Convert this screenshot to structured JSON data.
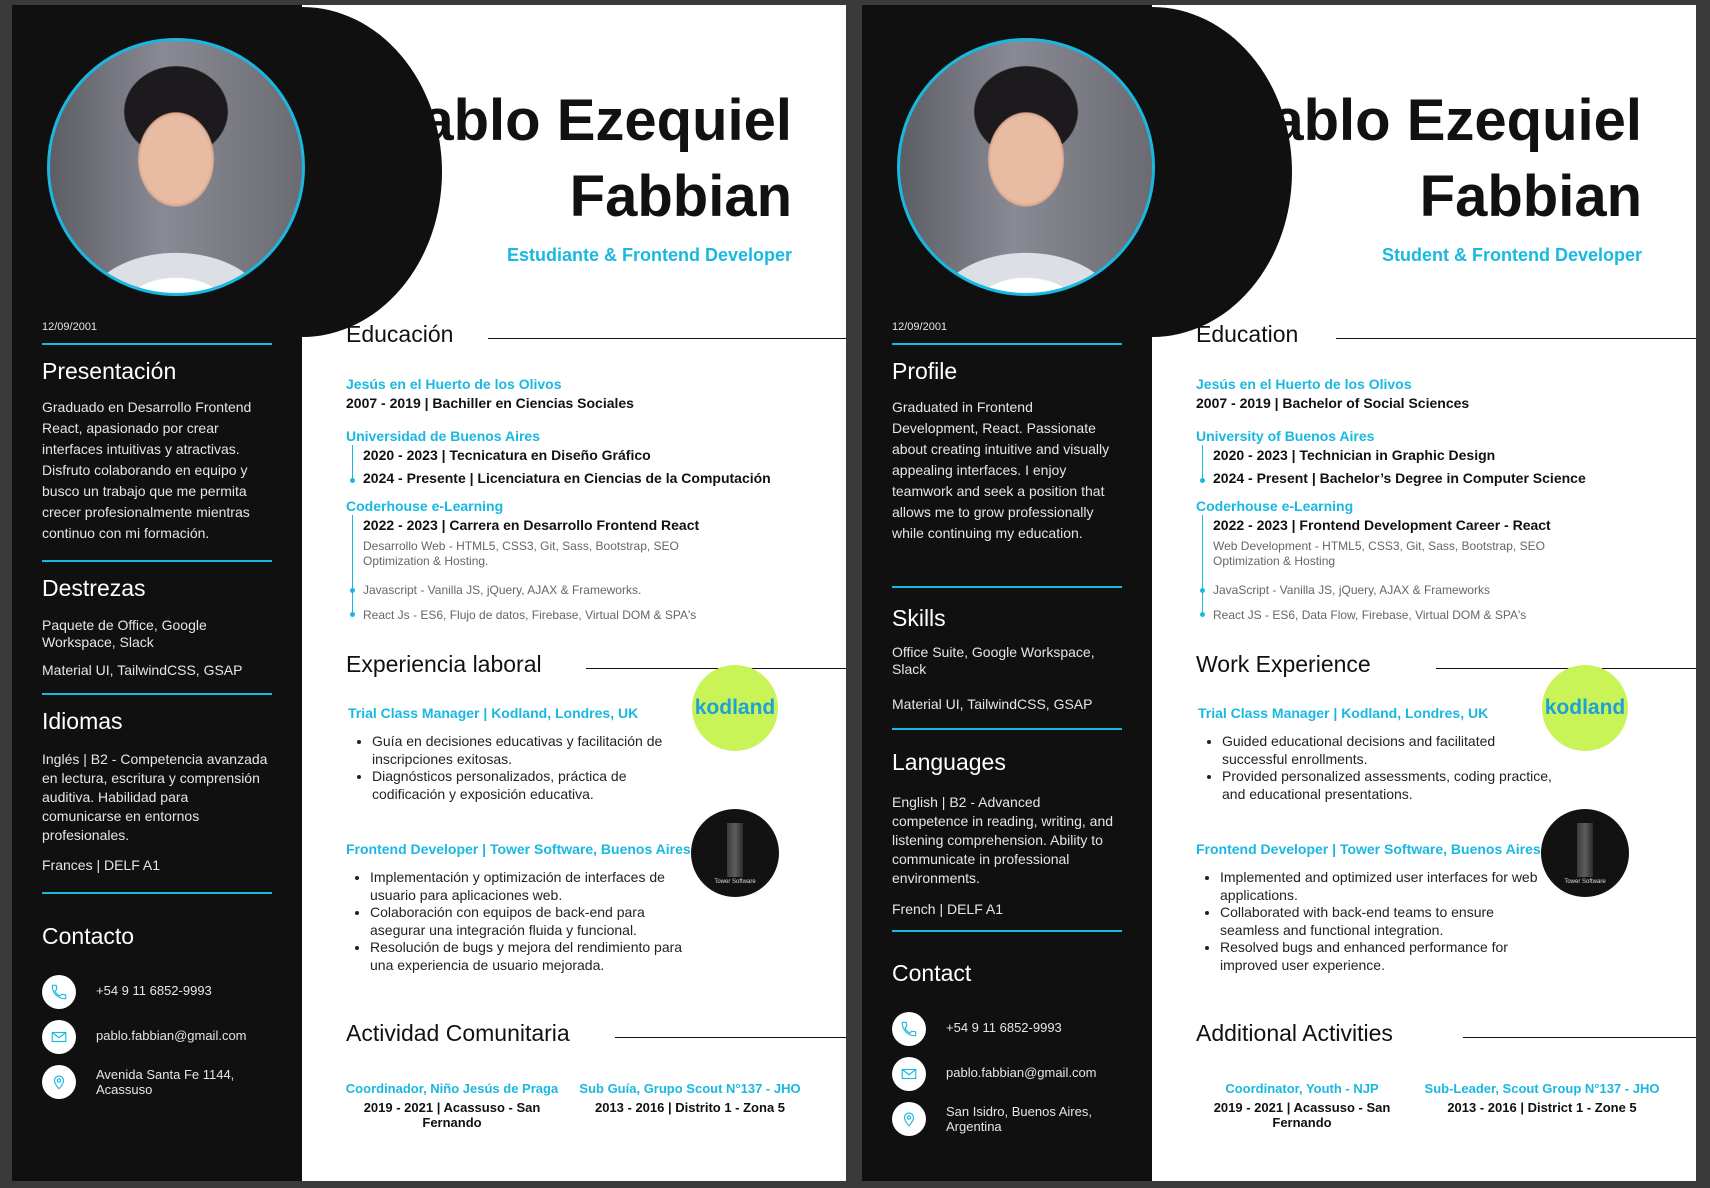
{
  "accent_color": "#19b8e0",
  "sidebar_color": "#101010",
  "es": {
    "name_line1": "Pablo Ezequiel",
    "name_line2": "Fabbian",
    "role": "Estudiante & Frontend Developer",
    "dob": "12/09/2001",
    "profile_title": "Presentación",
    "profile_text": "Graduado en Desarrollo Frontend React, apasionado por crear interfaces intuitivas y atractivas. Disfruto colaborando en equipo y busco un trabajo que me permita crecer profesionalmente mientras continuo con mi formación.",
    "skills_title": "Destrezas",
    "skills": [
      "Paquete de Office, Google Workspace, Slack",
      "Material UI, TailwindCSS, GSAP"
    ],
    "languages_title": "Idiomas",
    "languages": [
      "Inglés | B2 - Competencia avanzada en lectura, escritura y comprensión auditiva. Habilidad para comunicarse en entornos profesionales.",
      "Frances | DELF A1"
    ],
    "contact_title": "Contacto",
    "phone": "+54 9 11 6852-9993",
    "email": "pablo.fabbian@gmail.com",
    "address": "Avenida Santa Fe 1144, Acassuso",
    "education_title": "Educación",
    "edu": [
      {
        "inst": "Jesús en el Huerto de los Olivos",
        "degrees": [
          "2007 - 2019 | Bachiller en Ciencias Sociales"
        ]
      },
      {
        "inst": "Universidad de Buenos Aires",
        "degrees": [
          "2020 - 2023 | Tecnicatura en Diseño Gráfico",
          "2024 - Presente | Licenciatura en Ciencias de la Computación"
        ]
      },
      {
        "inst": "Coderhouse  e-Learning",
        "degrees": [
          "2022 - 2023 | Carrera en Desarrollo Frontend React"
        ],
        "details": [
          "Desarrollo Web - HTML5, CSS3, Git, Sass, Bootstrap, SEO Optimization & Hosting.",
          "Javascript - Vanilla JS, jQuery, AJAX & Frameworks.",
          "React Js - ES6, Flujo de datos, Firebase, Virtual DOM & SPA's"
        ]
      }
    ],
    "work_title": "Experiencia laboral",
    "jobs": [
      {
        "title": "Trial Class Manager | Kodland, Londres, UK",
        "bullets": [
          "Guía en decisiones educativas y facilitación de inscripciones exitosas.",
          "Diagnósticos personalizados, práctica de codificación y exposición educativa."
        ]
      },
      {
        "title": "Frontend Developer | Tower Software, Buenos Aires",
        "bullets": [
          "Implementación y optimización de interfaces de usuario para aplicaciones web.",
          "Colaboración con equipos de back-end para asegurar una integración fluida y funcional.",
          "Resolución de bugs y mejora del rendimiento para una experiencia de usuario mejorada."
        ]
      }
    ],
    "activities_title": "Actividad Comunitaria",
    "activities": [
      {
        "title": "Coordinador, Niño Jesús de Praga",
        "sub": "2019 - 2021 | Acassuso - San Fernando"
      },
      {
        "title": "Sub Guía, Grupo Scout N°137 - JHO",
        "sub": "2013 - 2016 | Distrito 1 - Zona 5"
      }
    ]
  },
  "en": {
    "name_line1": "Pablo Ezequiel",
    "name_line2": "Fabbian",
    "role": "Student & Frontend Developer",
    "dob": "12/09/2001",
    "profile_title": "Profile",
    "profile_text": "Graduated in Frontend Development, React. Passionate about creating intuitive and visually appealing interfaces. I enjoy teamwork and seek a position that allows me to grow professionally while continuing my education.",
    "skills_title": "Skills",
    "skills": [
      "Office Suite, Google Workspace, Slack",
      "Material UI, TailwindCSS, GSAP"
    ],
    "languages_title": "Languages",
    "languages": [
      "English | B2 - Advanced competence in reading, writing, and listening comprehension. Ability to communicate in professional environments.",
      "French | DELF A1"
    ],
    "contact_title": "Contact",
    "phone": "+54 9 11 6852-9993",
    "email": "pablo.fabbian@gmail.com",
    "address": "San Isidro, Buenos Aires, Argentina",
    "education_title": "Education",
    "edu": [
      {
        "inst": "Jesús en el Huerto de los Olivos",
        "degrees": [
          "2007 - 2019 | Bachelor of Social Sciences"
        ]
      },
      {
        "inst": "University of Buenos Aires",
        "degrees": [
          "2020 - 2023 | Technician in Graphic Design",
          "2024 - Present | Bachelor’s Degree in Computer Science"
        ]
      },
      {
        "inst": "Coderhouse  e-Learning",
        "degrees": [
          "2022 - 2023 | Frontend Development Career - React"
        ],
        "details": [
          "Web Development - HTML5, CSS3, Git, Sass, Bootstrap, SEO Optimization & Hosting",
          "JavaScript - Vanilla JS, jQuery, AJAX & Frameworks",
          "React JS - ES6, Data Flow, Firebase, Virtual DOM & SPA's"
        ]
      }
    ],
    "work_title": "Work Experience",
    "jobs": [
      {
        "title": "Trial Class Manager | Kodland, Londres, UK",
        "bullets": [
          "Guided educational decisions and facilitated successful enrollments.",
          "Provided personalized assessments, coding practice, and educational presentations."
        ]
      },
      {
        "title": "Frontend Developer | Tower Software, Buenos Aires",
        "bullets": [
          "Implemented and optimized user interfaces for web applications.",
          "Collaborated with back-end teams to ensure seamless and functional integration.",
          "Resolved bugs and enhanced performance for improved user experience."
        ]
      }
    ],
    "activities_title": "Additional Activities",
    "activities": [
      {
        "title": "Coordinator, Youth - NJP",
        "sub": "2019 - 2021 | Acassuso - San Fernando"
      },
      {
        "title": "Sub-Leader, Scout Group N°137 - JHO",
        "sub": "2013 - 2016 | District 1 - Zone 5"
      }
    ]
  },
  "logos": {
    "kodland": "kodland",
    "tower": "Tower Software"
  },
  "icons": {
    "phone": "phone-icon",
    "email": "email-icon",
    "location": "location-icon"
  }
}
